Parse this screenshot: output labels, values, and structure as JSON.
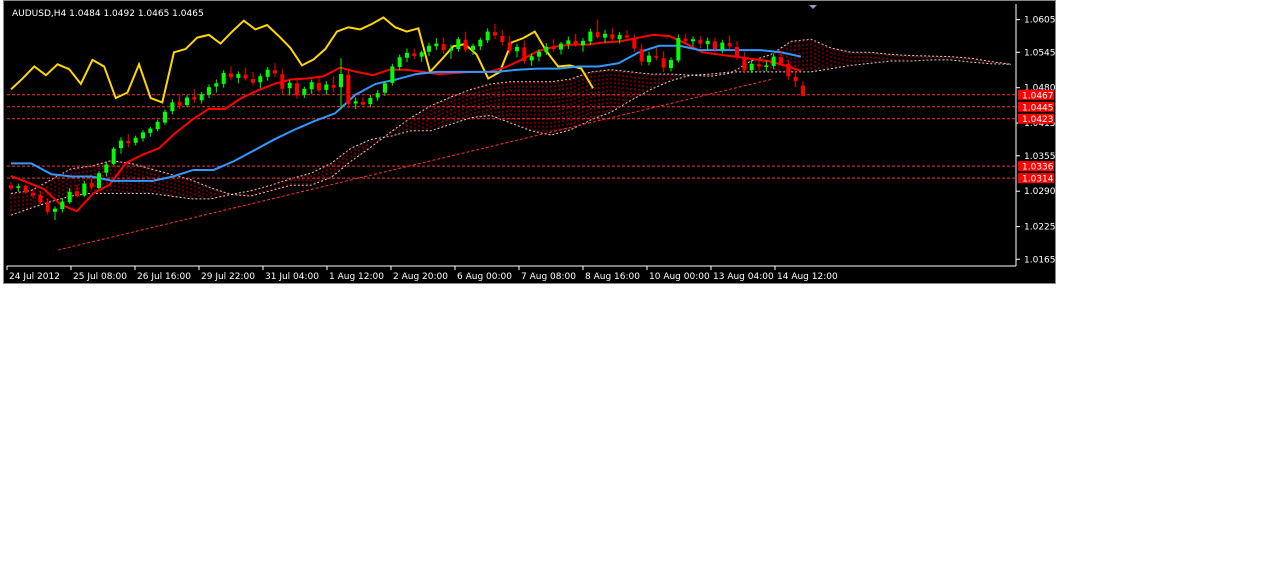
{
  "chart_data": {
    "type": "candlestick",
    "title": "AUDUSD,H4  1.0484 1.0492 1.0465 1.0465",
    "symbol": "AUDUSD",
    "timeframe": "H4",
    "ohlc_last": [
      1.0484,
      1.0492,
      1.0465,
      1.0465
    ],
    "background": "#000000",
    "up_color": "#00ff00",
    "down_color": "#ff0000",
    "ylim": [
      1.016,
      1.063
    ],
    "y_ticks": [
      "1.0605",
      "1.0545",
      "1.0480",
      "1.0415",
      "1.0355",
      "1.0290",
      "1.0225",
      "1.0165"
    ],
    "x_ticks": [
      "24 Jul 2012",
      "25 Jul 08:00",
      "26 Jul 16:00",
      "29 Jul 22:00",
      "31 Jul 04:00",
      "1 Aug 12:00",
      "2 Aug 20:00",
      "6 Aug 00:00",
      "7 Aug 08:00",
      "8 Aug 16:00",
      "10 Aug 00:00",
      "13 Aug 04:00",
      "14 Aug 12:00"
    ],
    "levels": [
      {
        "label": "1.0467",
        "value": 1.0467
      },
      {
        "label": "1.0445",
        "value": 1.0445
      },
      {
        "label": "1.0423",
        "value": 1.0423
      },
      {
        "label": "1.0336",
        "value": 1.0336
      },
      {
        "label": "1.0314",
        "value": 1.0314
      }
    ],
    "trendline": {
      "from": 1.0182,
      "to": 1.0496
    },
    "series": [
      {
        "type": "line",
        "color": "#ffd700",
        "values": [
          1.0477,
          1.0497,
          1.0519,
          1.0503,
          1.0523,
          1.0514,
          1.0487,
          1.0531,
          1.0519,
          1.0461,
          1.0471,
          1.0523,
          1.0461,
          1.0453,
          1.0545,
          1.0551,
          1.0572,
          1.0577,
          1.0561,
          1.0583,
          1.0603,
          1.0587,
          1.0595,
          1.0575,
          1.0553,
          1.0521,
          1.0532,
          1.0551,
          1.0583,
          1.0591,
          1.0587,
          1.0597,
          1.0609,
          1.0591,
          1.0583,
          1.0589,
          1.0509,
          1.0532,
          1.0556,
          1.056,
          1.0541,
          1.0497,
          1.0509,
          1.0563,
          1.0571,
          1.0583,
          1.0547,
          1.0519,
          1.0521,
          1.0515,
          1.0479
        ]
      },
      {
        "type": "line",
        "color": "#ff0000",
        "values": [
          1.0318,
          1.0306,
          1.0294,
          1.0266,
          1.0253,
          1.0286,
          1.0302,
          1.0342,
          1.0357,
          1.0369,
          1.0397,
          1.0421,
          1.0441,
          1.0441,
          1.0461,
          1.0475,
          1.0487,
          1.0495,
          1.0497,
          1.0501,
          1.0517,
          1.0509,
          1.0503,
          1.0513,
          1.0513,
          1.0509,
          1.0505,
          1.0507,
          1.0509,
          1.0509,
          1.0517,
          1.0531,
          1.0547,
          1.0555,
          1.0559,
          1.0559,
          1.0563,
          1.0565,
          1.0571,
          1.0577,
          1.0575,
          1.0561,
          1.0545,
          1.0541,
          1.0537,
          1.0533,
          1.0529,
          1.0521,
          1.0511
        ]
      },
      {
        "type": "line",
        "color": "#3399ff",
        "values": [
          1.0341,
          1.0341,
          1.0321,
          1.0317,
          1.0317,
          1.0309,
          1.0309,
          1.0309,
          1.0317,
          1.0329,
          1.0329,
          1.0345,
          1.0365,
          1.0385,
          1.0403,
          1.0419,
          1.0433,
          1.0467,
          1.0487,
          1.0495,
          1.0505,
          1.0509,
          1.0509,
          1.0509,
          1.0509,
          1.0513,
          1.0515,
          1.0515,
          1.0519,
          1.0519,
          1.0525,
          1.0545,
          1.0557,
          1.0557,
          1.0549,
          1.0549,
          1.0549,
          1.0549,
          1.0545,
          1.0537
        ]
      },
      {
        "type": "cloud",
        "color": "#ff0000",
        "upper": [
          1.0286,
          1.0291,
          1.0311,
          1.0331,
          1.0336,
          1.0346,
          1.0341,
          1.0331,
          1.0321,
          1.0311,
          1.0296,
          1.0284,
          1.0281,
          1.0291,
          1.0301,
          1.0301,
          1.0315,
          1.0345,
          1.0371,
          1.0399,
          1.0425,
          1.0447,
          1.0463,
          1.0477,
          1.0487,
          1.0491,
          1.0491,
          1.0491,
          1.0496,
          1.0509,
          1.0513,
          1.0509,
          1.0505,
          1.0505,
          1.0503,
          1.0501,
          1.0507,
          1.0529,
          1.0541,
          1.0565,
          1.0569,
          1.0553,
          1.0545,
          1.0545,
          1.0541,
          1.0539,
          1.0538,
          1.0537,
          1.0534,
          1.0528,
          1.0523
        ],
        "lower": [
          1.0246,
          1.0259,
          1.0271,
          1.0281,
          1.0286,
          1.0286,
          1.0286,
          1.0286,
          1.0281,
          1.0276,
          1.0276,
          1.0284,
          1.0291,
          1.0301,
          1.0313,
          1.0323,
          1.0341,
          1.0369,
          1.0385,
          1.0391,
          1.0401,
          1.0401,
          1.0413,
          1.0425,
          1.0429,
          1.0415,
          1.0401,
          1.0393,
          1.0403,
          1.0421,
          1.0435,
          1.0457,
          1.0477,
          1.0493,
          1.0503,
          1.0505,
          1.0509,
          1.0509,
          1.0509,
          1.0509,
          1.0509,
          1.0515,
          1.0521,
          1.0525,
          1.0529,
          1.0529,
          1.0531,
          1.0531,
          1.0527,
          1.0524,
          1.0523
        ]
      }
    ],
    "candles": [
      [
        1.0301,
        1.0307,
        1.0292,
        1.0295
      ],
      [
        1.0296,
        1.0304,
        1.0289,
        1.0299
      ],
      [
        1.03,
        1.0302,
        1.0285,
        1.0288
      ],
      [
        1.0287,
        1.0294,
        1.0277,
        1.0282
      ],
      [
        1.0283,
        1.029,
        1.0266,
        1.027
      ],
      [
        1.027,
        1.0276,
        1.0247,
        1.0252
      ],
      [
        1.0252,
        1.0262,
        1.0237,
        1.0258
      ],
      [
        1.0257,
        1.0277,
        1.0251,
        1.0271
      ],
      [
        1.027,
        1.0296,
        1.0267,
        1.0289
      ],
      [
        1.029,
        1.0301,
        1.0279,
        1.0281
      ],
      [
        1.0282,
        1.0309,
        1.028,
        1.0304
      ],
      [
        1.0305,
        1.0313,
        1.0293,
        1.0297
      ],
      [
        1.0296,
        1.0327,
        1.0294,
        1.0323
      ],
      [
        1.0324,
        1.0343,
        1.0317,
        1.0339
      ],
      [
        1.034,
        1.0371,
        1.0338,
        1.0368
      ],
      [
        1.0369,
        1.0389,
        1.0359,
        1.0383
      ],
      [
        1.0382,
        1.0395,
        1.037,
        1.0378
      ],
      [
        1.0379,
        1.0392,
        1.0374,
        1.0388
      ],
      [
        1.0387,
        1.0402,
        1.0381,
        1.0398
      ],
      [
        1.0397,
        1.0408,
        1.039,
        1.0405
      ],
      [
        1.0404,
        1.0421,
        1.04,
        1.0417
      ],
      [
        1.0416,
        1.044,
        1.0412,
        1.0436
      ],
      [
        1.0437,
        1.0459,
        1.0431,
        1.0453
      ],
      [
        1.0454,
        1.0468,
        1.0441,
        1.0447
      ],
      [
        1.0448,
        1.0466,
        1.0444,
        1.0462
      ],
      [
        1.0463,
        1.0478,
        1.0452,
        1.0458
      ],
      [
        1.0457,
        1.0472,
        1.0451,
        1.0468
      ],
      [
        1.0467,
        1.0486,
        1.0461,
        1.0481
      ],
      [
        1.0482,
        1.0495,
        1.0471,
        1.0488
      ],
      [
        1.0487,
        1.0512,
        1.048,
        1.0507
      ],
      [
        1.0506,
        1.0519,
        1.0494,
        1.0499
      ],
      [
        1.0498,
        1.051,
        1.0488,
        1.0505
      ],
      [
        1.0504,
        1.0517,
        1.0493,
        1.0497
      ],
      [
        1.0496,
        1.0509,
        1.0484,
        1.0489
      ],
      [
        1.049,
        1.0506,
        1.0479,
        1.0501
      ],
      [
        1.05,
        1.0518,
        1.0493,
        1.0513
      ],
      [
        1.0512,
        1.0525,
        1.05,
        1.0506
      ],
      [
        1.0505,
        1.0514,
        1.0469,
        1.0478
      ],
      [
        1.0479,
        1.0494,
        1.0466,
        1.0489
      ],
      [
        1.0488,
        1.0497,
        1.046,
        1.0466
      ],
      [
        1.0467,
        1.0482,
        1.0461,
        1.0478
      ],
      [
        1.0477,
        1.0495,
        1.0469,
        1.049
      ],
      [
        1.0489,
        1.0503,
        1.0471,
        1.0475
      ],
      [
        1.0476,
        1.0492,
        1.0467,
        1.0486
      ],
      [
        1.0485,
        1.0501,
        1.0472,
        1.048
      ],
      [
        1.0481,
        1.0534,
        1.044,
        1.0505
      ],
      [
        1.0504,
        1.0515,
        1.0442,
        1.045
      ],
      [
        1.0451,
        1.0462,
        1.0441,
        1.0455
      ],
      [
        1.0454,
        1.0462,
        1.0444,
        1.0449
      ],
      [
        1.045,
        1.0467,
        1.0444,
        1.0461
      ],
      [
        1.0462,
        1.0476,
        1.0456,
        1.047
      ],
      [
        1.0471,
        1.0492,
        1.0465,
        1.0488
      ],
      [
        1.0489,
        1.0524,
        1.0484,
        1.0519
      ],
      [
        1.0518,
        1.0541,
        1.0512,
        1.0536
      ],
      [
        1.0535,
        1.0552,
        1.0527,
        1.0544
      ],
      [
        1.0543,
        1.0552,
        1.0532,
        1.0538
      ],
      [
        1.0537,
        1.0548,
        1.0528,
        1.0545
      ],
      [
        1.0546,
        1.0563,
        1.0538,
        1.0557
      ],
      [
        1.0556,
        1.0571,
        1.0549,
        1.0561
      ],
      [
        1.056,
        1.0572,
        1.0542,
        1.0549
      ],
      [
        1.0548,
        1.0559,
        1.0533,
        1.0552
      ],
      [
        1.0551,
        1.0573,
        1.0546,
        1.0569
      ],
      [
        1.0568,
        1.0583,
        1.0545,
        1.055
      ],
      [
        1.0549,
        1.0561,
        1.054,
        1.0557
      ],
      [
        1.0556,
        1.0572,
        1.0549,
        1.0568
      ],
      [
        1.0567,
        1.0589,
        1.0562,
        1.0583
      ],
      [
        1.0582,
        1.0597,
        1.0569,
        1.0576
      ],
      [
        1.0575,
        1.0586,
        1.0558,
        1.0564
      ],
      [
        1.0563,
        1.0575,
        1.0541,
        1.0548
      ],
      [
        1.0547,
        1.0561,
        1.0536,
        1.0555
      ],
      [
        1.0554,
        1.0567,
        1.0524,
        1.0529
      ],
      [
        1.053,
        1.0543,
        1.052,
        1.0538
      ],
      [
        1.0537,
        1.0551,
        1.0528,
        1.0546
      ],
      [
        1.0545,
        1.0562,
        1.054,
        1.0555
      ],
      [
        1.0554,
        1.0569,
        1.0546,
        1.0551
      ],
      [
        1.055,
        1.0564,
        1.0541,
        1.0561
      ],
      [
        1.056,
        1.0574,
        1.0551,
        1.0567
      ],
      [
        1.0566,
        1.0579,
        1.0555,
        1.0559
      ],
      [
        1.0558,
        1.0571,
        1.0546,
        1.0566
      ],
      [
        1.0565,
        1.0588,
        1.0558,
        1.0583
      ],
      [
        1.0582,
        1.0605,
        1.057,
        1.0573
      ],
      [
        1.0572,
        1.0586,
        1.0562,
        1.0579
      ],
      [
        1.0578,
        1.0589,
        1.0566,
        1.057
      ],
      [
        1.0569,
        1.0582,
        1.0561,
        1.0577
      ],
      [
        1.0576,
        1.0586,
        1.0566,
        1.0572
      ],
      [
        1.0571,
        1.0578,
        1.0546,
        1.0552
      ],
      [
        1.0551,
        1.056,
        1.0521,
        1.0528
      ],
      [
        1.0527,
        1.0546,
        1.0521,
        1.0539
      ],
      [
        1.0538,
        1.0553,
        1.053,
        1.0535
      ],
      [
        1.0534,
        1.0547,
        1.0509,
        1.0517
      ],
      [
        1.0516,
        1.0536,
        1.051,
        1.0531
      ],
      [
        1.053,
        1.0578,
        1.0526,
        1.0571
      ],
      [
        1.057,
        1.0579,
        1.0559,
        1.0566
      ],
      [
        1.0565,
        1.0574,
        1.0556,
        1.0569
      ],
      [
        1.0568,
        1.0575,
        1.0552,
        1.0561
      ],
      [
        1.056,
        1.0572,
        1.0548,
        1.0566
      ],
      [
        1.0565,
        1.0572,
        1.0545,
        1.0551
      ],
      [
        1.055,
        1.0568,
        1.0543,
        1.0563
      ],
      [
        1.0562,
        1.0576,
        1.0551,
        1.0556
      ],
      [
        1.0555,
        1.0566,
        1.0531,
        1.0536
      ],
      [
        1.0535,
        1.0546,
        1.0506,
        1.0513
      ],
      [
        1.0512,
        1.0531,
        1.0507,
        1.0524
      ],
      [
        1.0523,
        1.0534,
        1.0513,
        1.0519
      ],
      [
        1.0518,
        1.053,
        1.051,
        1.0521
      ],
      [
        1.052,
        1.0543,
        1.0514,
        1.0537
      ],
      [
        1.0536,
        1.0548,
        1.0521,
        1.0525
      ],
      [
        1.0524,
        1.0532,
        1.0494,
        1.0501
      ],
      [
        1.05,
        1.0511,
        1.0481,
        1.0492
      ],
      [
        1.0484,
        1.0492,
        1.0465,
        1.0465
      ]
    ]
  }
}
